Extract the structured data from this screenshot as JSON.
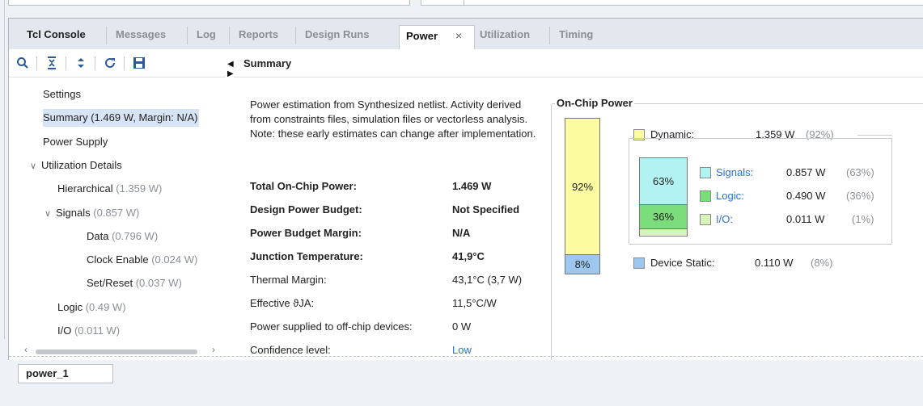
{
  "tabs": [
    {
      "label": "Tcl Console",
      "state": "dark"
    },
    {
      "label": "Messages",
      "state": "muted"
    },
    {
      "label": "Log",
      "state": "muted"
    },
    {
      "label": "Reports",
      "state": "muted"
    },
    {
      "label": "Design Runs",
      "state": "muted"
    },
    {
      "label": "Power",
      "state": "active",
      "close": "×"
    },
    {
      "label": "Utilization",
      "state": "muted"
    },
    {
      "label": "Timing",
      "state": "muted"
    }
  ],
  "toolbar": {
    "icons": [
      "search-icon",
      "collapse-all-icon",
      "expand-all-icon",
      "refresh-icon",
      "save-icon"
    ]
  },
  "tree": [
    {
      "label": "Settings",
      "value": "",
      "indent": 0,
      "chevron": "",
      "selected": false
    },
    {
      "label": "Summary (1.469 W, Margin: N/A)",
      "value": "",
      "indent": 0,
      "chevron": "",
      "selected": true
    },
    {
      "label": "Power Supply",
      "value": "",
      "indent": 0,
      "chevron": "",
      "selected": false
    },
    {
      "label": "Utilization Details",
      "value": "",
      "indent": 0,
      "chevron": "∨",
      "selected": false
    },
    {
      "label": "Hierarchical",
      "value": " (1.359 W)",
      "indent": 1,
      "chevron": "",
      "selected": false
    },
    {
      "label": "Signals",
      "value": " (0.857 W)",
      "indent": 1,
      "chevron": "∨",
      "selected": false
    },
    {
      "label": "Data",
      "value": " (0.796 W)",
      "indent": 2,
      "chevron": "",
      "selected": false
    },
    {
      "label": "Clock Enable",
      "value": " (0.024 W)",
      "indent": 2,
      "chevron": "",
      "selected": false
    },
    {
      "label": "Set/Reset",
      "value": " (0.037 W)",
      "indent": 2,
      "chevron": "",
      "selected": false
    },
    {
      "label": "Logic",
      "value": " (0.49 W)",
      "indent": 1,
      "chevron": "",
      "selected": false
    },
    {
      "label": "I/O",
      "value": " (0.011 W)",
      "indent": 1,
      "chevron": "",
      "selected": false
    }
  ],
  "summary": {
    "header": "Summary",
    "description": "Power estimation from Synthesized netlist. Activity derived from constraints files, simulation files or vectorless analysis. Note: these early estimates can change after implementation.",
    "rows": [
      {
        "label": "Total On-Chip Power:",
        "value": "1.469 W",
        "bold": true,
        "link": false
      },
      {
        "label": "Design Power Budget:",
        "value": "Not Specified",
        "bold": true,
        "link": false
      },
      {
        "label": "Power Budget Margin:",
        "value": "N/A",
        "bold": true,
        "link": false
      },
      {
        "label": "Junction Temperature:",
        "value": "41,9°C",
        "bold": true,
        "link": false
      },
      {
        "label": "Thermal Margin:",
        "value": "43,1°C (3,7 W)",
        "bold": false,
        "link": false
      },
      {
        "label": "Effective ϑJA:",
        "value": "11,5°C/W",
        "bold": false,
        "link": false
      },
      {
        "label": "Power supplied to off-chip devices:",
        "value": "0 W",
        "bold": false,
        "link": false
      },
      {
        "label": "Confidence level:",
        "value": "Low",
        "bold": false,
        "link": true
      }
    ]
  },
  "on_chip": {
    "title": "On-Chip Power",
    "dynamic": {
      "label": "Dynamic:",
      "value": "1.359 W",
      "pct": "(92%)",
      "bar_label": "92%",
      "fraction": 0.92,
      "color": "#fbfba0"
    },
    "static": {
      "label": "Device Static:",
      "value": "0.110 W",
      "pct": "(8%)",
      "bar_label": "8%",
      "fraction": 0.08,
      "color": "#9dc7ee"
    },
    "signals": {
      "label": "Signals:",
      "value": "0.857 W",
      "pct": "(63%)",
      "bar_label": "63%",
      "fraction": 0.63,
      "color": "#b2f2f2"
    },
    "logic": {
      "label": "Logic:",
      "value": "0.490 W",
      "pct": "(36%)",
      "bar_label": "36%",
      "fraction": 0.36,
      "color": "#7bdc7b"
    },
    "io": {
      "label": "I/O:",
      "value": "0.011 W",
      "pct": "(1%)",
      "bar_label": "",
      "fraction": 0.01,
      "color": "#d6f4b8"
    }
  },
  "bottom_tab": "power_1"
}
